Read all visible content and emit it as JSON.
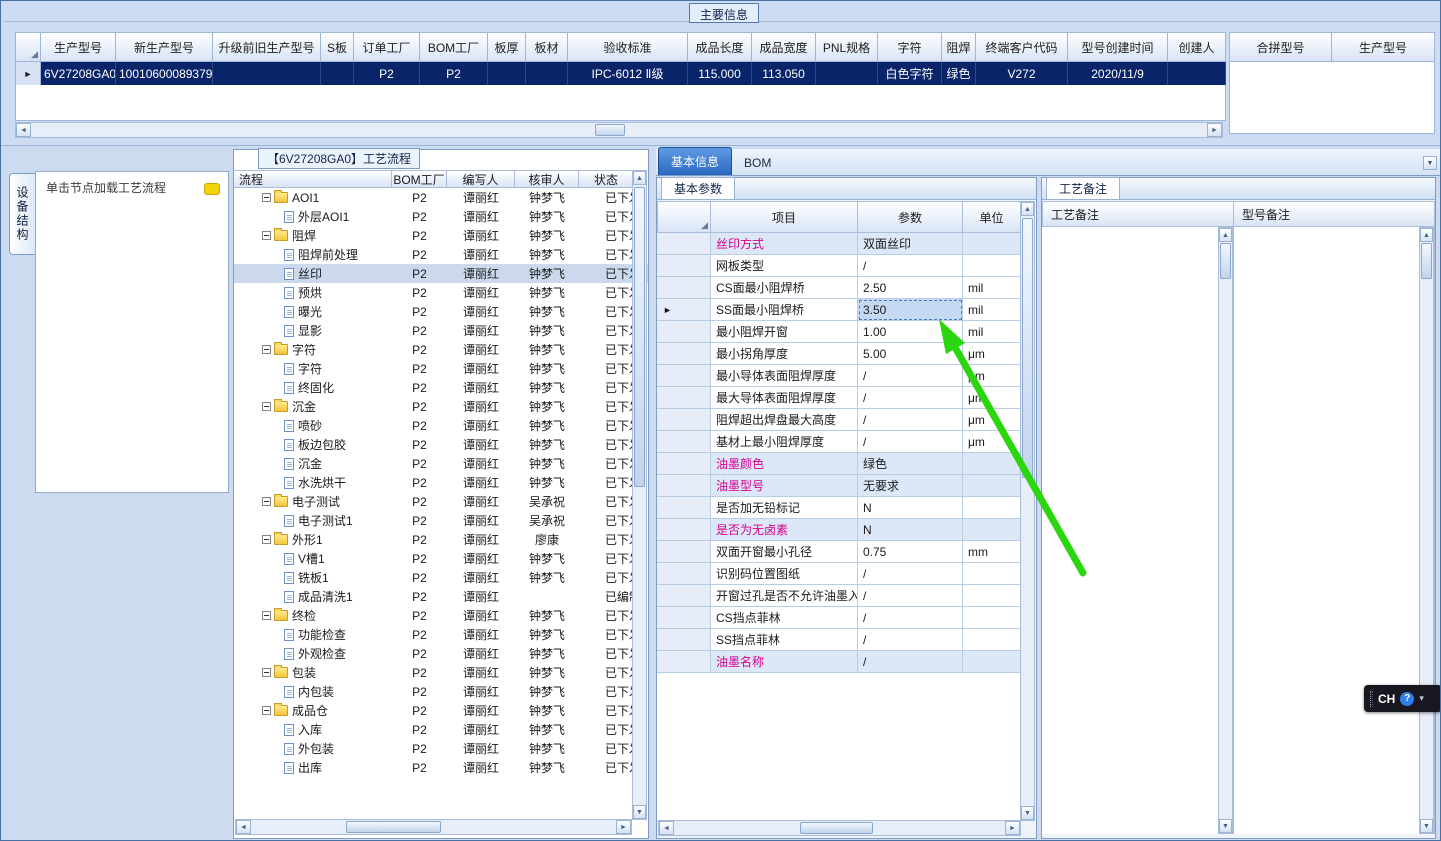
{
  "main_info": {
    "title": "主要信息",
    "columns": [
      "生产型号",
      "新生产型号",
      "升级前旧生产型号",
      "S板",
      "订单工厂",
      "BOM工厂",
      "板厚",
      "板材",
      "验收标准",
      "成品长度",
      "成品宽度",
      "PNL规格",
      "字符",
      "阻焊",
      "终端客户代码",
      "型号创建时间",
      "创建人"
    ],
    "row": [
      "6V27208GA0",
      "10010600089379",
      "",
      "",
      "P2",
      "P2",
      "",
      "",
      "IPC-6012 Ⅱ级",
      "115.000",
      "113.050",
      "",
      "白色字符",
      "绿色",
      "V272",
      "2020/11/9",
      ""
    ],
    "extra_columns": [
      "合拼型号",
      "生产型号"
    ]
  },
  "left_panel": {
    "vertical_tab": "设备结构",
    "hint": "单击节点加载工艺流程"
  },
  "process_flow": {
    "title": "【6V27208GA0】工艺流程",
    "columns": [
      "流程",
      "BOM工厂",
      "编写人",
      "核审人",
      "状态"
    ],
    "rows": [
      {
        "folder": true,
        "label": "AOI1",
        "bom": "P2",
        "writer": "谭丽红",
        "reviewer": "钟梦飞",
        "status": "已下发"
      },
      {
        "label": "外层AOI1",
        "bom": "P2",
        "writer": "谭丽红",
        "reviewer": "钟梦飞",
        "status": "已下发"
      },
      {
        "folder": true,
        "label": "阻焊",
        "bom": "P2",
        "writer": "谭丽红",
        "reviewer": "钟梦飞",
        "status": "已下发"
      },
      {
        "label": "阻焊前处理",
        "bom": "P2",
        "writer": "谭丽红",
        "reviewer": "钟梦飞",
        "status": "已下发"
      },
      {
        "label": "丝印",
        "bom": "P2",
        "writer": "谭丽红",
        "reviewer": "钟梦飞",
        "status": "已下发",
        "selected": true
      },
      {
        "label": "预烘",
        "bom": "P2",
        "writer": "谭丽红",
        "reviewer": "钟梦飞",
        "status": "已下发"
      },
      {
        "label": "曝光",
        "bom": "P2",
        "writer": "谭丽红",
        "reviewer": "钟梦飞",
        "status": "已下发"
      },
      {
        "label": "显影",
        "bom": "P2",
        "writer": "谭丽红",
        "reviewer": "钟梦飞",
        "status": "已下发"
      },
      {
        "folder": true,
        "label": "字符",
        "bom": "P2",
        "writer": "谭丽红",
        "reviewer": "钟梦飞",
        "status": "已下发"
      },
      {
        "label": "字符",
        "bom": "P2",
        "writer": "谭丽红",
        "reviewer": "钟梦飞",
        "status": "已下发"
      },
      {
        "label": "终固化",
        "bom": "P2",
        "writer": "谭丽红",
        "reviewer": "钟梦飞",
        "status": "已下发"
      },
      {
        "folder": true,
        "label": "沉金",
        "bom": "P2",
        "writer": "谭丽红",
        "reviewer": "钟梦飞",
        "status": "已下发"
      },
      {
        "label": "喷砂",
        "bom": "P2",
        "writer": "谭丽红",
        "reviewer": "钟梦飞",
        "status": "已下发"
      },
      {
        "label": "板边包胶",
        "bom": "P2",
        "writer": "谭丽红",
        "reviewer": "钟梦飞",
        "status": "已下发"
      },
      {
        "label": "沉金",
        "bom": "P2",
        "writer": "谭丽红",
        "reviewer": "钟梦飞",
        "status": "已下发"
      },
      {
        "label": "水洗烘干",
        "bom": "P2",
        "writer": "谭丽红",
        "reviewer": "钟梦飞",
        "status": "已下发"
      },
      {
        "folder": true,
        "label": "电子测试",
        "bom": "P2",
        "writer": "谭丽红",
        "reviewer": "吴承祝",
        "status": "已下发"
      },
      {
        "label": "电子测试1",
        "bom": "P2",
        "writer": "谭丽红",
        "reviewer": "吴承祝",
        "status": "已下发"
      },
      {
        "folder": true,
        "label": "外形1",
        "bom": "P2",
        "writer": "谭丽红",
        "reviewer": "廖康",
        "status": "已下发"
      },
      {
        "label": "V槽1",
        "bom": "P2",
        "writer": "谭丽红",
        "reviewer": "钟梦飞",
        "status": "已下发"
      },
      {
        "label": "铣板1",
        "bom": "P2",
        "writer": "谭丽红",
        "reviewer": "钟梦飞",
        "status": "已下发"
      },
      {
        "label": "成品清洗1",
        "bom": "P2",
        "writer": "谭丽红",
        "reviewer": "",
        "status": "已编制"
      },
      {
        "folder": true,
        "label": "终检",
        "bom": "P2",
        "writer": "谭丽红",
        "reviewer": "钟梦飞",
        "status": "已下发"
      },
      {
        "label": "功能检查",
        "bom": "P2",
        "writer": "谭丽红",
        "reviewer": "钟梦飞",
        "status": "已下发"
      },
      {
        "label": "外观检查",
        "bom": "P2",
        "writer": "谭丽红",
        "reviewer": "钟梦飞",
        "status": "已下发"
      },
      {
        "folder": true,
        "label": "包装",
        "bom": "P2",
        "writer": "谭丽红",
        "reviewer": "钟梦飞",
        "status": "已下发"
      },
      {
        "label": "内包装",
        "bom": "P2",
        "writer": "谭丽红",
        "reviewer": "钟梦飞",
        "status": "已下发"
      },
      {
        "folder": true,
        "label": "成品仓",
        "bom": "P2",
        "writer": "谭丽红",
        "reviewer": "钟梦飞",
        "status": "已下发"
      },
      {
        "label": "入库",
        "bom": "P2",
        "writer": "谭丽红",
        "reviewer": "钟梦飞",
        "status": "已下发"
      },
      {
        "label": "外包装",
        "bom": "P2",
        "writer": "谭丽红",
        "reviewer": "钟梦飞",
        "status": "已下发"
      },
      {
        "label": "出库",
        "bom": "P2",
        "writer": "谭丽红",
        "reviewer": "钟梦飞",
        "status": "已下发"
      }
    ]
  },
  "params": {
    "tabs": [
      "基本信息",
      "BOM"
    ],
    "sub_tab": "基本参数",
    "columns": [
      "项目",
      "参数",
      "单位"
    ],
    "rows": [
      {
        "label": "丝印方式",
        "value": "双面丝印",
        "unit": "",
        "magenta": true
      },
      {
        "label": "网板类型",
        "value": "/",
        "unit": ""
      },
      {
        "label": "CS面最小阻焊桥",
        "value": "2.50",
        "unit": "mil"
      },
      {
        "label": "SS面最小阻焊桥",
        "value": "3.50",
        "unit": "mil",
        "selected": true
      },
      {
        "label": "最小阻焊开窗",
        "value": "1.00",
        "unit": "mil"
      },
      {
        "label": "最小拐角厚度",
        "value": "5.00",
        "unit": "μm"
      },
      {
        "label": "最小导体表面阻焊厚度",
        "value": "/",
        "unit": "μm"
      },
      {
        "label": "最大导体表面阻焊厚度",
        "value": "/",
        "unit": "μm"
      },
      {
        "label": "阻焊超出焊盘最大高度",
        "value": "/",
        "unit": "μm"
      },
      {
        "label": "基材上最小阻焊厚度",
        "value": "/",
        "unit": "μm"
      },
      {
        "label": "油墨颜色",
        "value": "绿色",
        "unit": "",
        "magenta": true
      },
      {
        "label": "油墨型号",
        "value": "无要求",
        "unit": "",
        "magenta": true
      },
      {
        "label": "是否加无铅标记",
        "value": "N",
        "unit": ""
      },
      {
        "label": "是否为无卤素",
        "value": "N",
        "unit": "",
        "magenta": true
      },
      {
        "label": "双面开窗最小孔径",
        "value": "0.75",
        "unit": "mm"
      },
      {
        "label": "识别码位置图纸",
        "value": "/",
        "unit": ""
      },
      {
        "label": "开窗过孔是否不允许油墨入孔",
        "value": "/",
        "unit": ""
      },
      {
        "label": "CS挡点菲林",
        "value": "/",
        "unit": ""
      },
      {
        "label": "SS挡点菲林",
        "value": "/",
        "unit": ""
      },
      {
        "label": "油墨名称",
        "value": "/",
        "unit": "",
        "magenta": true
      }
    ]
  },
  "notes": {
    "tab": "工艺备注",
    "columns": [
      "工艺备注",
      "型号备注"
    ]
  },
  "language_bar": {
    "label": "CH",
    "help": "?"
  },
  "colors": {
    "selection_navy": "#0a246a",
    "magenta_label": "#d6008f",
    "arrow_green": "#2bd60f",
    "active_tab_blue": "#2a66c0"
  }
}
